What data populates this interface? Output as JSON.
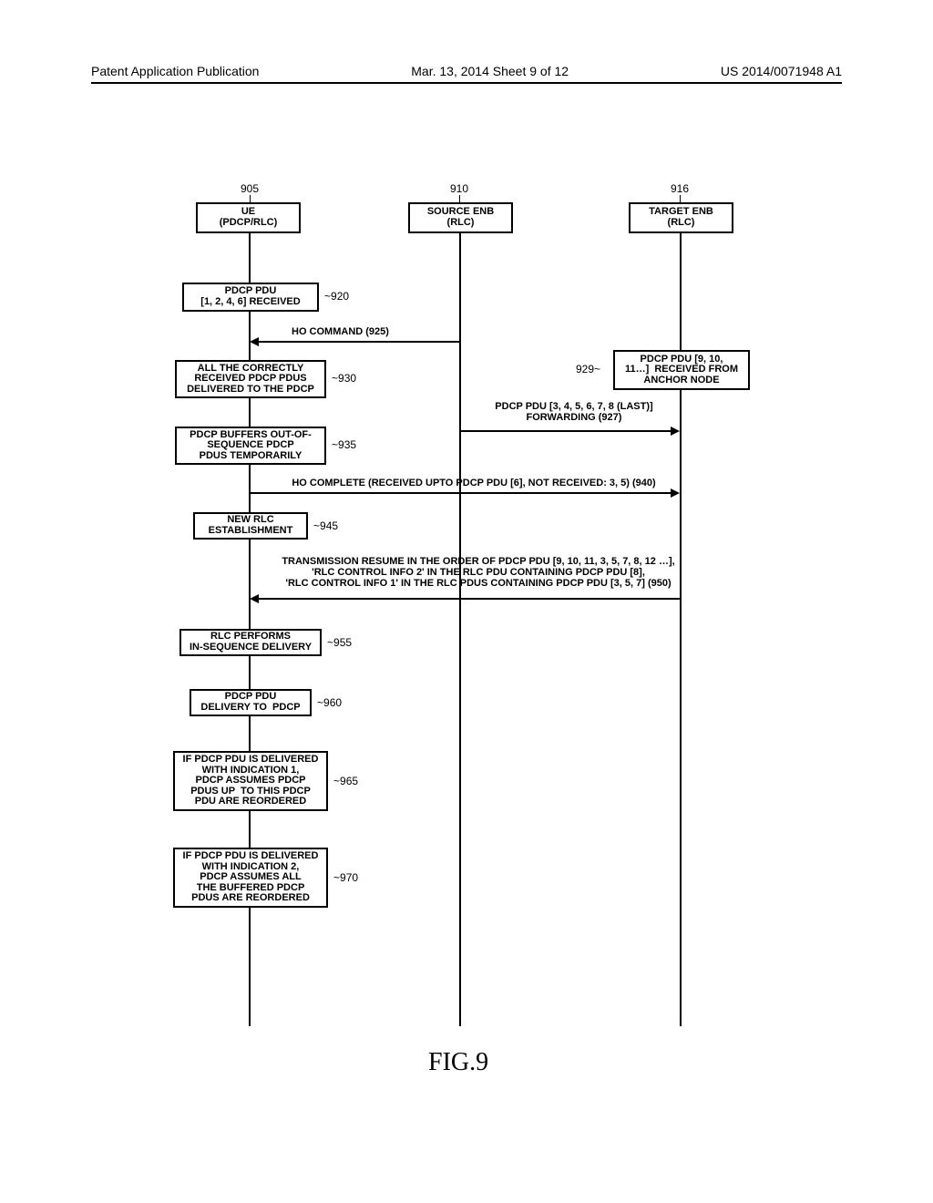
{
  "header": {
    "left": "Patent Application Publication",
    "mid": "Mar. 13, 2014  Sheet 9 of 12",
    "right": "US 2014/0071948 A1"
  },
  "entities": {
    "ue": {
      "num": "905",
      "label1": "UE",
      "label2": "(PDCP/RLC)"
    },
    "src": {
      "num": "910",
      "label1": "SOURCE ENB",
      "label2": "(RLC)"
    },
    "tgt": {
      "num": "916",
      "label1": "TARGET ENB",
      "label2": "(RLC)"
    }
  },
  "boxes": {
    "b920": "PDCP PDU\n[1, 2, 4, 6] RECEIVED",
    "b930": "ALL THE CORRECTLY\nRECEIVED PDCP PDUS\nDELIVERED TO THE PDCP",
    "b935": "PDCP BUFFERS OUT-OF-\nSEQUENCE PDCP\nPDUS TEMPORARILY",
    "b945": "NEW RLC\nESTABLISHMENT",
    "b955": "RLC PERFORMS\nIN-SEQUENCE DELIVERY",
    "b960": "PDCP PDU\nDELIVERY TO  PDCP",
    "b965": "IF PDCP PDU IS DELIVERED\nWITH INDICATION 1,\nPDCP ASSUMES PDCP\nPDUS UP  TO THIS PDCP\nPDU ARE REORDERED",
    "b970": "IF PDCP PDU IS DELIVERED\nWITH INDICATION 2,\nPDCP ASSUMES ALL\nTHE BUFFERED PDCP\nPDUS ARE REORDERED",
    "b929": "PDCP PDU [9, 10,\n11…]  RECEIVED FROM\nANCHOR NODE"
  },
  "refs": {
    "r920": "920",
    "r930": "930",
    "r935": "935",
    "r945": "945",
    "r955": "955",
    "r960": "960",
    "r965": "965",
    "r970": "970",
    "r929": "929"
  },
  "arrows": {
    "a925": "HO COMMAND (925)",
    "a927": "PDCP PDU [3, 4, 5, 6, 7, 8 (LAST)]\nFORWARDING (927)",
    "a940": "HO COMPLETE (RECEIVED UPTO PDCP PDU [6], NOT RECEIVED: 3, 5) (940)",
    "a950": "TRANSMISSION RESUME IN THE ORDER OF PDCP PDU [9, 10, 11, 3, 5, 7, 8, 12 …],\n'RLC CONTROL INFO 2' IN THE RLC PDU CONTAINING PDCP PDU [8],\n'RLC CONTROL INFO 1' IN THE RLC PDUS CONTAINING PDCP PDU [3, 5, 7] (950)"
  },
  "figure": "FIG.9"
}
